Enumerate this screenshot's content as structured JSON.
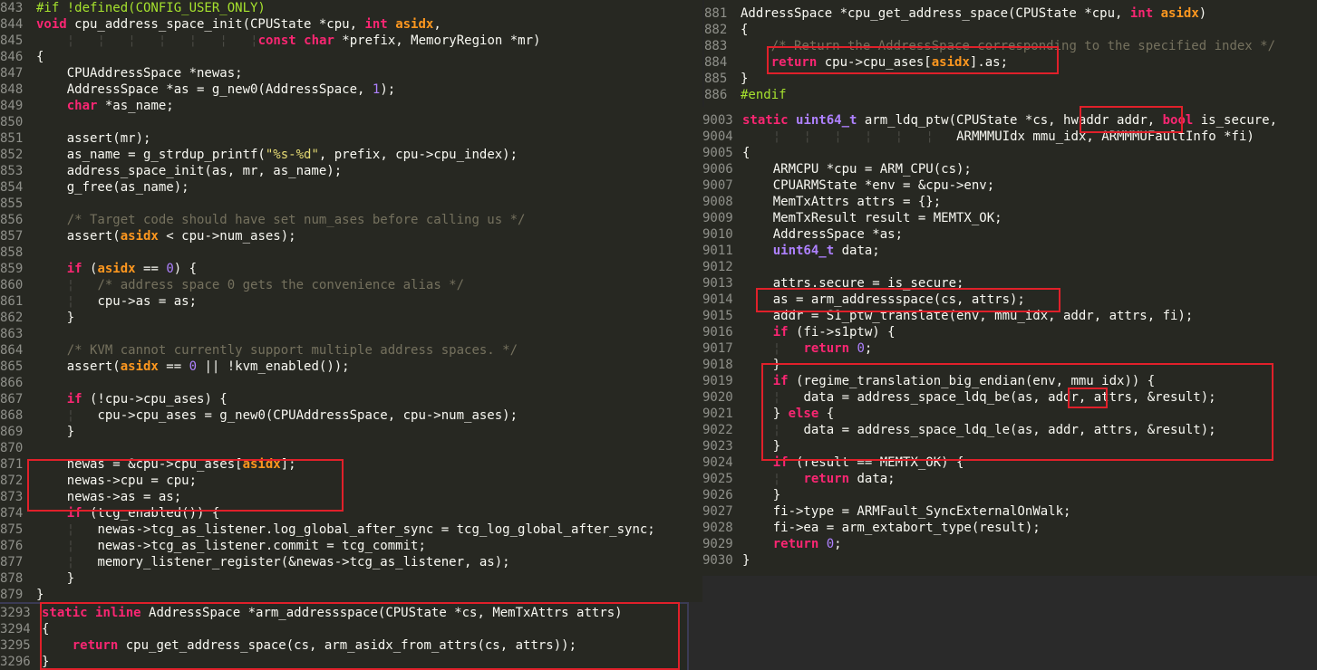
{
  "left_pane": {
    "lines": [
      {
        "n": "843",
        "t": "#if !defined(CONFIG_USER_ONLY)"
      },
      {
        "n": "844",
        "t": "void cpu_address_space_init(CPUState *cpu, int asidx,"
      },
      {
        "n": "845",
        "t": "                             const char *prefix, MemoryRegion *mr)"
      },
      {
        "n": "846",
        "t": "{"
      },
      {
        "n": "847",
        "t": "    CPUAddressSpace *newas;"
      },
      {
        "n": "848",
        "t": "    AddressSpace *as = g_new0(AddressSpace, 1);"
      },
      {
        "n": "849",
        "t": "    char *as_name;"
      },
      {
        "n": "850",
        "t": ""
      },
      {
        "n": "851",
        "t": "    assert(mr);"
      },
      {
        "n": "852",
        "t": "    as_name = g_strdup_printf(\"%s-%d\", prefix, cpu->cpu_index);"
      },
      {
        "n": "853",
        "t": "    address_space_init(as, mr, as_name);"
      },
      {
        "n": "854",
        "t": "    g_free(as_name);"
      },
      {
        "n": "855",
        "t": ""
      },
      {
        "n": "856",
        "t": "    /* Target code should have set num_ases before calling us */"
      },
      {
        "n": "857",
        "t": "    assert(asidx < cpu->num_ases);"
      },
      {
        "n": "858",
        "t": ""
      },
      {
        "n": "859",
        "t": "    if (asidx == 0) {"
      },
      {
        "n": "860",
        "t": "        /* address space 0 gets the convenience alias */"
      },
      {
        "n": "861",
        "t": "        cpu->as = as;"
      },
      {
        "n": "862",
        "t": "    }"
      },
      {
        "n": "863",
        "t": ""
      },
      {
        "n": "864",
        "t": "    /* KVM cannot currently support multiple address spaces. */"
      },
      {
        "n": "865",
        "t": "    assert(asidx == 0 || !kvm_enabled());"
      },
      {
        "n": "866",
        "t": ""
      },
      {
        "n": "867",
        "t": "    if (!cpu->cpu_ases) {"
      },
      {
        "n": "868",
        "t": "        cpu->cpu_ases = g_new0(CPUAddressSpace, cpu->num_ases);"
      },
      {
        "n": "869",
        "t": "    }"
      },
      {
        "n": "870",
        "t": ""
      },
      {
        "n": "871",
        "t": "    newas = &cpu->cpu_ases[asidx];"
      },
      {
        "n": "872",
        "t": "    newas->cpu = cpu;"
      },
      {
        "n": "873",
        "t": "    newas->as = as;"
      },
      {
        "n": "874",
        "t": "    if (tcg_enabled()) {"
      },
      {
        "n": "875",
        "t": "        newas->tcg_as_listener.log_global_after_sync = tcg_log_global_after_sync;"
      },
      {
        "n": "876",
        "t": "        newas->tcg_as_listener.commit = tcg_commit;"
      },
      {
        "n": "877",
        "t": "        memory_listener_register(&newas->tcg_as_listener, as);"
      },
      {
        "n": "878",
        "t": "    }"
      },
      {
        "n": "879",
        "t": "}"
      }
    ]
  },
  "top_right_pane": {
    "lines": [
      {
        "n": "881",
        "t": "AddressSpace *cpu_get_address_space(CPUState *cpu, int asidx)"
      },
      {
        "n": "882",
        "t": "{"
      },
      {
        "n": "883",
        "t": "    /* Return the AddressSpace corresponding to the specified index */"
      },
      {
        "n": "884",
        "t": "    return cpu->cpu_ases[asidx].as;"
      },
      {
        "n": "885",
        "t": "}"
      },
      {
        "n": "886",
        "t": "#endif"
      }
    ]
  },
  "right_main_pane": {
    "lines": [
      {
        "n": "9003",
        "t": "static uint64_t arm_ldq_ptw(CPUState *cs, hwaddr addr, bool is_secure,"
      },
      {
        "n": "9004",
        "t": "                            ARMMMUIdx mmu_idx, ARMMMUFaultInfo *fi)"
      },
      {
        "n": "9005",
        "t": "{"
      },
      {
        "n": "9006",
        "t": "    ARMCPU *cpu = ARM_CPU(cs);"
      },
      {
        "n": "9007",
        "t": "    CPUARMState *env = &cpu->env;"
      },
      {
        "n": "9008",
        "t": "    MemTxAttrs attrs = {};"
      },
      {
        "n": "9009",
        "t": "    MemTxResult result = MEMTX_OK;"
      },
      {
        "n": "9010",
        "t": "    AddressSpace *as;"
      },
      {
        "n": "9011",
        "t": "    uint64_t data;"
      },
      {
        "n": "9012",
        "t": ""
      },
      {
        "n": "9013",
        "t": "    attrs.secure = is_secure;"
      },
      {
        "n": "9014",
        "t": "    as = arm_addressspace(cs, attrs);"
      },
      {
        "n": "9015",
        "t": "    addr = S1_ptw_translate(env, mmu_idx, addr, attrs, fi);"
      },
      {
        "n": "9016",
        "t": "    if (fi->s1ptw) {"
      },
      {
        "n": "9017",
        "t": "        return 0;"
      },
      {
        "n": "9018",
        "t": "    }"
      },
      {
        "n": "9019",
        "t": "    if (regime_translation_big_endian(env, mmu_idx)) {"
      },
      {
        "n": "9020",
        "t": "        data = address_space_ldq_be(as, addr, attrs, &result);"
      },
      {
        "n": "9021",
        "t": "    } else {"
      },
      {
        "n": "9022",
        "t": "        data = address_space_ldq_le(as, addr, attrs, &result);"
      },
      {
        "n": "9023",
        "t": "    }"
      },
      {
        "n": "9024",
        "t": "    if (result == MEMTX_OK) {"
      },
      {
        "n": "9025",
        "t": "        return data;"
      },
      {
        "n": "9026",
        "t": "    }"
      },
      {
        "n": "9027",
        "t": "    fi->type = ARMFault_SyncExternalOnWalk;"
      },
      {
        "n": "9028",
        "t": "    fi->ea = arm_extabort_type(result);"
      },
      {
        "n": "9029",
        "t": "    return 0;"
      },
      {
        "n": "9030",
        "t": "}"
      }
    ]
  },
  "bottom_pane": {
    "lines": [
      {
        "n": "3293",
        "t": "static inline AddressSpace *arm_addressspace(CPUState *cs, MemTxAttrs attrs)"
      },
      {
        "n": "3294",
        "t": "{"
      },
      {
        "n": "3295",
        "t": "    return cpu_get_address_space(cs, arm_asidx_from_attrs(cs, attrs));"
      },
      {
        "n": "3296",
        "t": "}"
      }
    ]
  },
  "colors": {
    "background": "#272822",
    "keyword": "#f92672",
    "type": "#66d9ef",
    "highlight_box": "#e0202a",
    "comment": "#75715e",
    "string": "#e6db74",
    "number": "#ae81ff",
    "preprocessor": "#a6e22e"
  }
}
